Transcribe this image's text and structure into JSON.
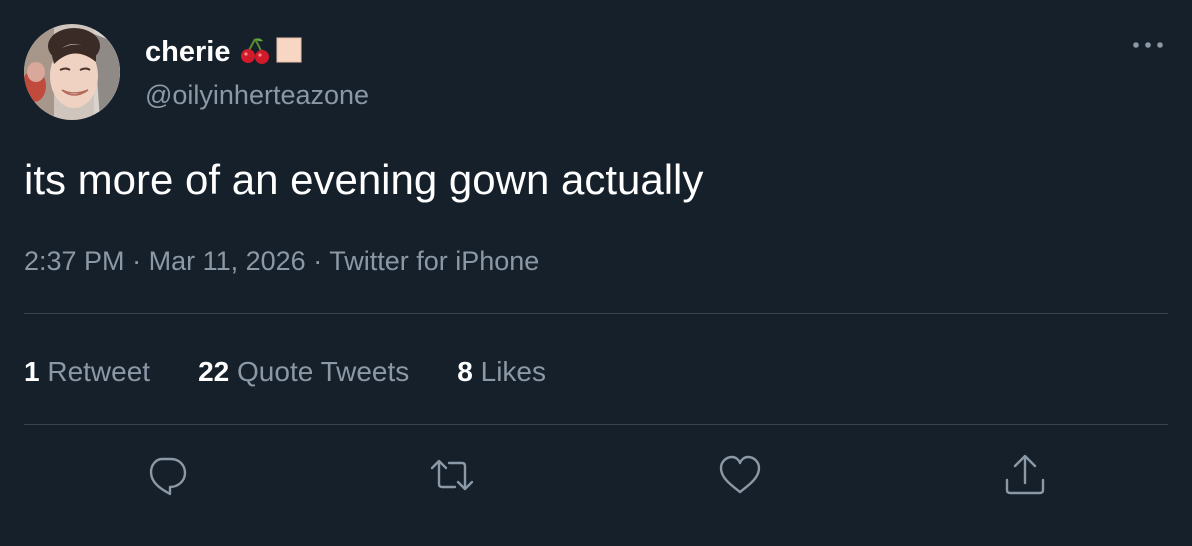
{
  "tweet": {
    "author": {
      "display_name": "cherie",
      "emoji": [
        "cherry-emoji",
        "skin-tone-square-emoji"
      ],
      "handle": "@oilyinherteazone"
    },
    "text": "its more of an evening gown actually",
    "meta": {
      "time": "2:37 PM",
      "separator1": "·",
      "date": "Mar 11, 2026",
      "separator2": "·",
      "source": "Twitter for iPhone"
    },
    "stats": {
      "retweets": {
        "count": "1",
        "label": "Retweet"
      },
      "quotes": {
        "count": "22",
        "label": "Quote Tweets"
      },
      "likes": {
        "count": "8",
        "label": "Likes"
      }
    },
    "actions": [
      "reply-icon",
      "retweet-icon",
      "like-icon",
      "share-icon"
    ]
  },
  "colors": {
    "background": "#15202b",
    "primary_text": "#ffffff",
    "secondary_text": "#8b98a5",
    "divider": "#38444d"
  }
}
